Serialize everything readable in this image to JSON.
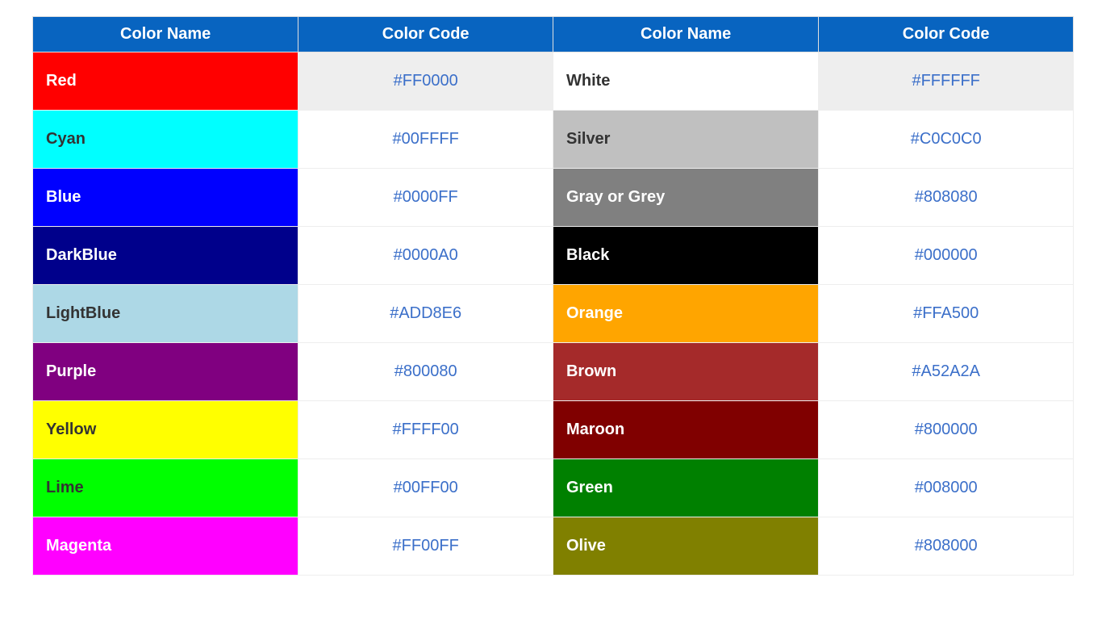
{
  "headers": [
    "Color Name",
    "Color Code",
    "Color Name",
    "Color Code"
  ],
  "rows": [
    {
      "left": {
        "name": "Red",
        "code": "#FF0000",
        "bg": "#FF0000",
        "fg": "#ffffff"
      },
      "right": {
        "name": "White",
        "code": "#FFFFFF",
        "bg": "#FFFFFF",
        "fg": "#333333"
      },
      "codeShaded": true
    },
    {
      "left": {
        "name": "Cyan",
        "code": "#00FFFF",
        "bg": "#00FFFF",
        "fg": "#333333"
      },
      "right": {
        "name": "Silver",
        "code": "#C0C0C0",
        "bg": "#C0C0C0",
        "fg": "#333333"
      },
      "codeShaded": false
    },
    {
      "left": {
        "name": "Blue",
        "code": "#0000FF",
        "bg": "#0000FF",
        "fg": "#ffffff"
      },
      "right": {
        "name": "Gray or Grey",
        "code": "#808080",
        "bg": "#808080",
        "fg": "#ffffff"
      },
      "codeShaded": false
    },
    {
      "left": {
        "name": "DarkBlue",
        "code": "#0000A0",
        "bg": "#00008B",
        "fg": "#ffffff"
      },
      "right": {
        "name": "Black",
        "code": "#000000",
        "bg": "#000000",
        "fg": "#ffffff"
      },
      "codeShaded": false
    },
    {
      "left": {
        "name": "LightBlue",
        "code": "#ADD8E6",
        "bg": "#ADD8E6",
        "fg": "#333333"
      },
      "right": {
        "name": "Orange",
        "code": "#FFA500",
        "bg": "#FFA500",
        "fg": "#ffffff"
      },
      "codeShaded": false
    },
    {
      "left": {
        "name": "Purple",
        "code": "#800080",
        "bg": "#800080",
        "fg": "#ffffff"
      },
      "right": {
        "name": "Brown",
        "code": "#A52A2A",
        "bg": "#A52A2A",
        "fg": "#ffffff"
      },
      "codeShaded": false
    },
    {
      "left": {
        "name": "Yellow",
        "code": "#FFFF00",
        "bg": "#FFFF00",
        "fg": "#333333"
      },
      "right": {
        "name": "Maroon",
        "code": "#800000",
        "bg": "#800000",
        "fg": "#ffffff"
      },
      "codeShaded": false
    },
    {
      "left": {
        "name": "Lime",
        "code": "#00FF00",
        "bg": "#00FF00",
        "fg": "#333333"
      },
      "right": {
        "name": "Green",
        "code": "#008000",
        "bg": "#008000",
        "fg": "#ffffff"
      },
      "codeShaded": false
    },
    {
      "left": {
        "name": "Magenta",
        "code": "#FF00FF",
        "bg": "#FF00FF",
        "fg": "#ffffff"
      },
      "right": {
        "name": "Olive",
        "code": "#808000",
        "bg": "#808000",
        "fg": "#ffffff"
      },
      "codeShaded": false
    }
  ]
}
